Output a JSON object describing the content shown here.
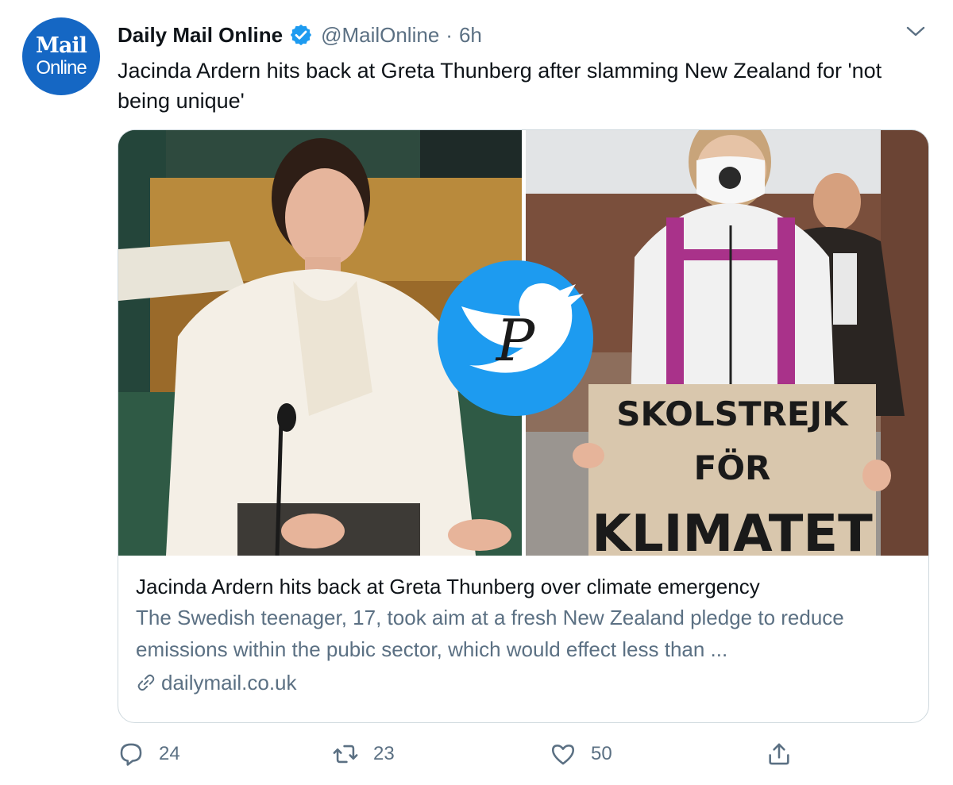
{
  "account": {
    "avatar_line1": "Mail",
    "avatar_line2": "Online",
    "name": "Daily Mail Online",
    "handle": "@MailOnline",
    "separator": "·",
    "time": "6h"
  },
  "tweet": {
    "text": "Jacinda Ardern hits back at Greta Thunberg after slamming New Zealand for 'not being unique'"
  },
  "card": {
    "sign_lines": [
      "SKOLSTREJK",
      "FÖR",
      "KLIMATET"
    ],
    "title": "Jacinda Ardern hits back at Greta Thunberg over climate emergency",
    "description": "The Swedish teenager, 17, took aim at a fresh New Zealand pledge to reduce emissions within the pubic sector, which would effect less than ...",
    "domain": "dailymail.co.uk",
    "watermark_letter": "P"
  },
  "actions": {
    "replies": "24",
    "retweets": "23",
    "likes": "50"
  },
  "icons": {
    "verified": "verified-badge-icon",
    "caret": "chevron-down-icon",
    "link": "link-icon",
    "reply": "reply-icon",
    "retweet": "retweet-icon",
    "like": "heart-icon",
    "share": "share-icon"
  },
  "colors": {
    "brand_blue": "#1567c4",
    "twitter_blue": "#1d9bf0",
    "secondary_text": "#5b7083",
    "border": "#cfd9de"
  }
}
